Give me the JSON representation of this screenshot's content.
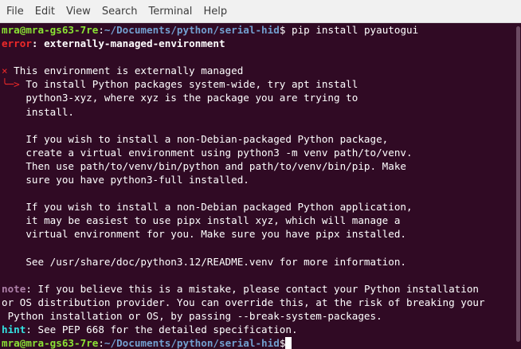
{
  "menu": [
    "File",
    "Edit",
    "View",
    "Search",
    "Terminal",
    "Help"
  ],
  "prompt": {
    "userhost": "mra@mra-gs63-7re",
    "colon": ":",
    "path": "~/Documents/python/serial-hid",
    "symbol": "$"
  },
  "command": " pip install pyautogui",
  "error": {
    "label": "error",
    "sep": ": ",
    "message": "externally-managed-environment"
  },
  "cross": "×",
  "headline": " This environment is externally managed",
  "arrow": "╰─>",
  "body_lines": [
    " To install Python packages system-wide, try apt install",
    "    python3-xyz, where xyz is the package you are trying to",
    "    install.",
    "",
    "    If you wish to install a non-Debian-packaged Python package,",
    "    create a virtual environment using python3 -m venv path/to/venv.",
    "    Then use path/to/venv/bin/python and path/to/venv/bin/pip. Make",
    "    sure you have python3-full installed.",
    "",
    "    If you wish to install a non-Debian packaged Python application,",
    "    it may be easiest to use pipx install xyz, which will manage a",
    "    virtual environment for you. Make sure you have pipx installed.",
    "",
    "    See /usr/share/doc/python3.12/README.venv for more information.",
    ""
  ],
  "note": {
    "label": "note",
    "lines": [
      ": If you believe this is a mistake, please contact your Python installation",
      "or OS distribution provider. You can override this, at the risk of breaking your",
      " Python installation or OS, by passing --break-system-packages."
    ]
  },
  "hint": {
    "label": "hint",
    "text": ": See PEP 668 for the detailed specification."
  }
}
